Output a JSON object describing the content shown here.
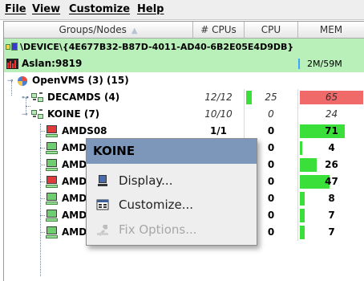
{
  "menubar": {
    "items": [
      "File",
      "View",
      "Customize",
      "Help"
    ]
  },
  "table": {
    "headers": {
      "groups": "Groups/Nodes",
      "cpus": "# CPUs",
      "cpu": "CPU",
      "mem": "MEM"
    },
    "device_row": "\\DEVICE\\{4E677B32-B87D-4011-AD40-6B2E05E4D9DB}",
    "host_row": {
      "name": "Aslan:9819",
      "mem": "2M/59M"
    },
    "group_row": {
      "name": "OpenVMS (3) (15)"
    },
    "rows": [
      {
        "name": "DECAMDS (4)",
        "cpus": "12/12",
        "cpu": "25",
        "mem": "65",
        "cpu_pct": 0.25,
        "mem_pct": 1.0,
        "mem_color": "#f06a6a"
      },
      {
        "name": "KOINE (7)",
        "cpus": "10/10",
        "cpu": "0",
        "mem": "24",
        "cpu_pct": 0.0,
        "mem_pct": 0.0,
        "mem_color": "#3adf3a"
      },
      {
        "name": "AMDS08",
        "cpus": "1/1",
        "cpu": "0",
        "mem": "71",
        "cpu_pct": 0.0,
        "mem_pct": 0.71,
        "mem_color": "#3adf3a"
      },
      {
        "name": "AMDS09",
        "cpus": "1/1",
        "cpu": "0",
        "mem": "4",
        "cpu_pct": 0.0,
        "mem_pct": 0.04,
        "mem_color": "#3adf3a"
      },
      {
        "name": "AMDS10",
        "cpus": "1/1",
        "cpu": "0",
        "mem": "26",
        "cpu_pct": 0.0,
        "mem_pct": 0.26,
        "mem_color": "#3adf3a"
      },
      {
        "name": "AMDS11",
        "cpus": "1/1",
        "cpu": "0",
        "mem": "47",
        "cpu_pct": 0.0,
        "mem_pct": 0.47,
        "mem_color": "#3adf3a"
      },
      {
        "name": "AMDS14",
        "cpus": "1/1",
        "cpu": "0",
        "mem": "8",
        "cpu_pct": 0.0,
        "mem_pct": 0.08,
        "mem_color": "#3adf3a"
      },
      {
        "name": "AMDS12",
        "cpus": "1/1",
        "cpu": "0",
        "mem": "7",
        "cpu_pct": 0.0,
        "mem_pct": 0.07,
        "mem_color": "#3adf3a"
      },
      {
        "name": "AMDS13",
        "cpus": "1/1",
        "cpu": "0",
        "mem": "7",
        "cpu_pct": 0.0,
        "mem_pct": 0.07,
        "mem_color": "#3adf3a"
      }
    ]
  },
  "context_menu": {
    "title": "KOINE",
    "items": [
      {
        "label": "Display...",
        "icon": "monitor-icon",
        "enabled": true
      },
      {
        "label": "Customize...",
        "icon": "customize-icon",
        "enabled": true
      },
      {
        "label": "Fix Options...",
        "icon": "fix-options-icon",
        "enabled": false
      }
    ]
  }
}
